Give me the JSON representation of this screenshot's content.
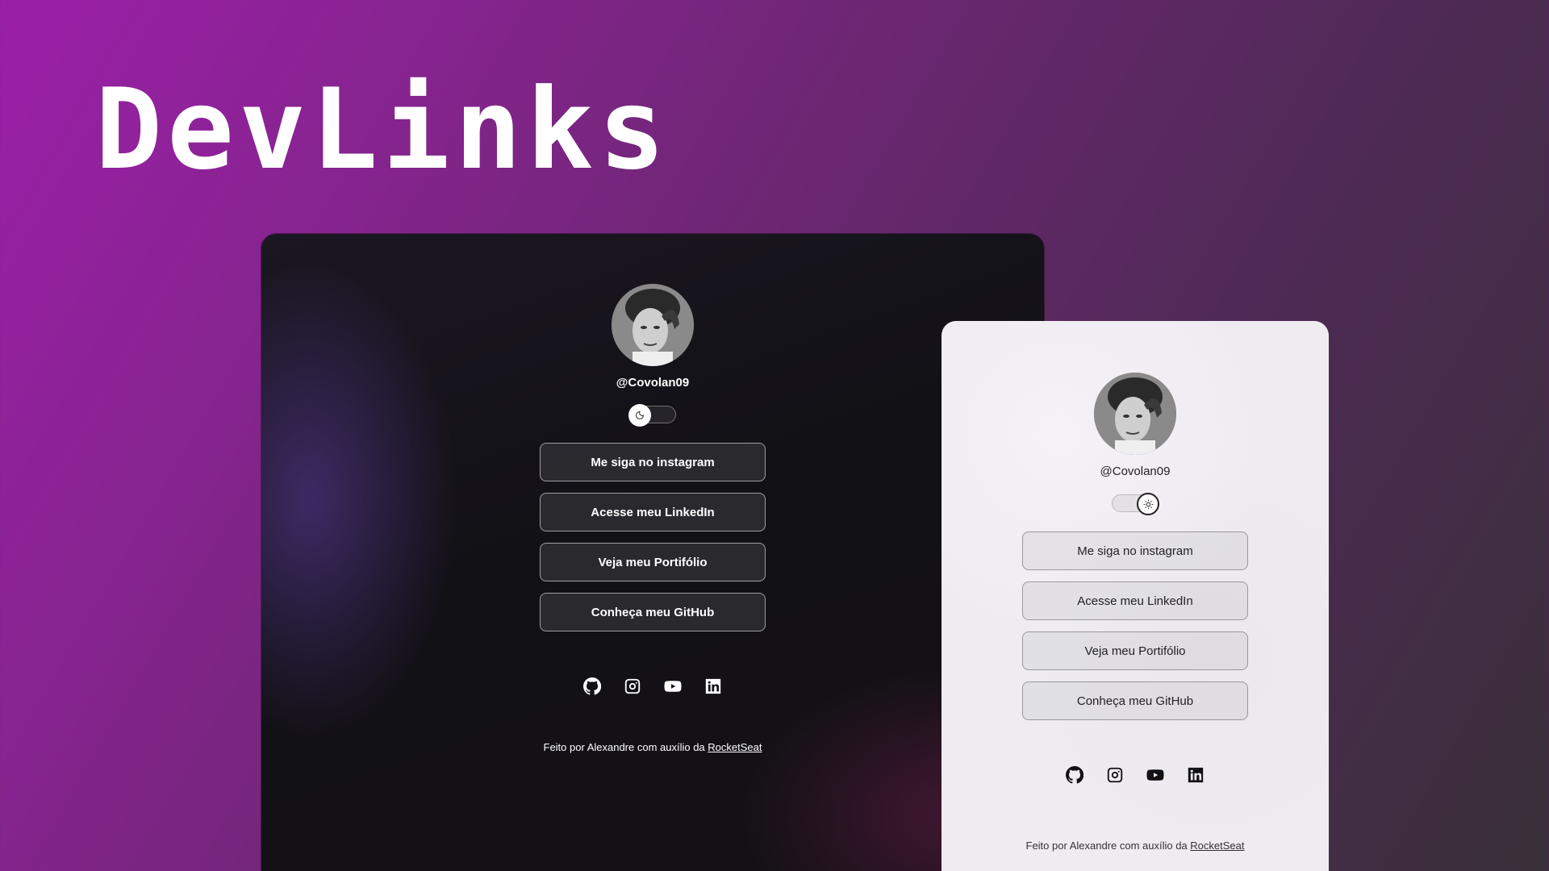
{
  "hero": {
    "title": "DevLinks"
  },
  "profile": {
    "handle": "@Covolan09"
  },
  "links": [
    {
      "label": "Me siga no instagram"
    },
    {
      "label": "Acesse meu LinkedIn"
    },
    {
      "label": "Veja meu Portifólio"
    },
    {
      "label": "Conheça meu GitHub"
    }
  ],
  "social": [
    "github-icon",
    "instagram-icon",
    "youtube-icon",
    "linkedin-icon"
  ],
  "footer": {
    "text": "Feito por Alexandre com auxílio da ",
    "link": "RocketSeat"
  },
  "toggle": {
    "dark_icon": "moon-icon",
    "light_icon": "sun-icon"
  },
  "colors": {
    "bg_start": "#9b1fa8",
    "bg_end": "#3a3039",
    "dark_surface": "#121116",
    "light_surface": "#eeecf0"
  }
}
